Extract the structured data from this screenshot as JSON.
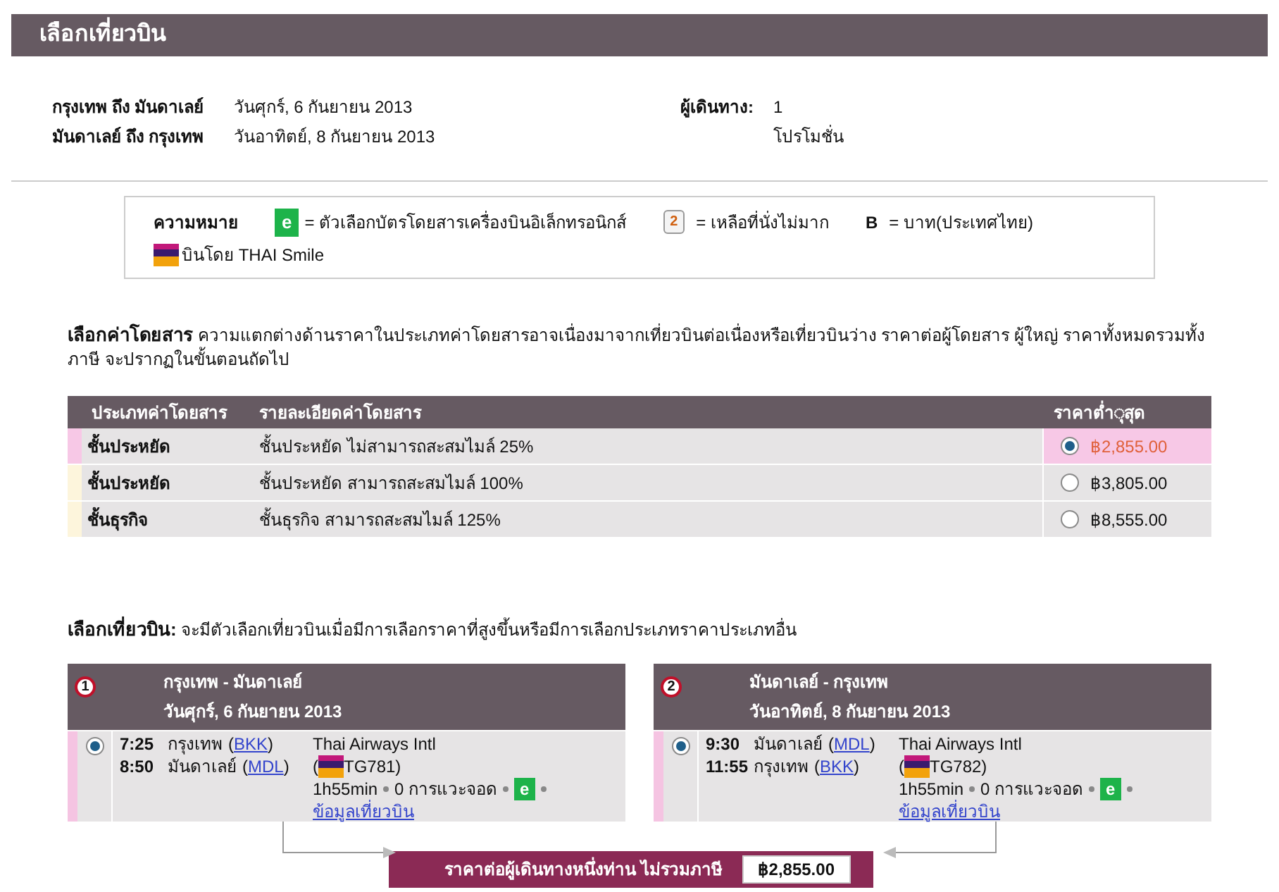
{
  "title": "เลือกเที่ยวบิน",
  "trip": {
    "routes": [
      {
        "label": "กรุงเทพ ถึง มันดาเลย์",
        "date": "วันศุกร์, 6 กันยายน 2013"
      },
      {
        "label": "มันดาเลย์ ถึง กรุงเทพ",
        "date": "วันอาทิตย์, 8 กันยายน 2013"
      }
    ],
    "passengers_label": "ผู้เดินทาง:",
    "passengers_value": "1",
    "promo": "โปรโมชั่น"
  },
  "legend": {
    "label": "ความหมาย",
    "items": [
      {
        "kind": "eticket",
        "icon": "e",
        "text": "= ตัวเลือกบัตรโดยสารเครื่องบินอิเล็กทรอนิกส์"
      },
      {
        "kind": "seats",
        "icon": "2",
        "text": "= เหลือที่นั่งไม่มาก"
      },
      {
        "kind": "currency",
        "icon": "B",
        "text": "= บาท(ประเทศไทย)"
      },
      {
        "kind": "smile",
        "text": "บินโดย THAI Smile"
      }
    ]
  },
  "fare_intro": {
    "label": "เลือกค่าโดยสาร",
    "text": "ความแตกต่างด้านราคาในประเภทค่าโดยสารอาจเนื่องมาจากเที่ยวบินต่อเนื่องหรือเที่ยวบินว่าง ราคาต่อผู้โดยสาร ผู้ใหญ่ ราคาทั้งหมดรวมทั้ง ภาษี จะปรากฏในขั้นตอนถัดไป"
  },
  "fare_table": {
    "columns": [
      "ประเภทค่าโดยสาร",
      "รายละเอียดค่าโดยสาร",
      "ราคาต่ำ◌ุสุด"
    ],
    "rows": [
      {
        "type": "ชั้นประหยัด",
        "detail": "ชั้นประหยัด ไม่สามารถสะสมไมล์ 25%",
        "price": "฿2,855.00",
        "selected": true
      },
      {
        "type": "ชั้นประหยัด",
        "detail": "ชั้นประหยัด สามารถสะสมไมล์ 100%",
        "price": "฿3,805.00",
        "selected": false
      },
      {
        "type": "ชั้นธุรกิจ",
        "detail": "ชั้นธุรกิจ สามารถสะสมไมล์ 125%",
        "price": "฿8,555.00",
        "selected": false
      }
    ]
  },
  "flight_intro": {
    "label": "เลือกเที่ยวบิน:",
    "text": "จะมีตัวเลือกเที่ยวบินเมื่อมีการเลือกราคาที่สูงขึ้นหรือมีการเลือกประเภทราคาประเภทอื่น"
  },
  "flights": [
    {
      "number": "1",
      "route": "กรุงเทพ - มันดาเลย์",
      "date": "วันศุกร์, 6 กันยายน 2013",
      "selected": true,
      "depart_time": "7:25",
      "depart_city": "กรุงเทพ",
      "depart_open": "(",
      "depart_code": "BKK",
      "depart_close": ")",
      "arrive_time": "8:50",
      "arrive_city": "มันดาเลย์",
      "arrive_open": "(",
      "arrive_code": "MDL",
      "arrive_close": ")",
      "airline": "Thai Airways Intl",
      "paren": "(",
      "flight_code": "TG781)",
      "duration": "1h55min",
      "stops": "0 การแวะจอด",
      "eticket": "e",
      "info_link": "ข้อมูลเที่ยวบิน"
    },
    {
      "number": "2",
      "route": "มันดาเลย์ - กรุงเทพ",
      "date": "วันอาทิตย์, 8 กันยายน 2013",
      "selected": true,
      "depart_time": "9:30",
      "depart_city": "มันดาเลย์",
      "depart_open": "(",
      "depart_code": "MDL",
      "depart_close": ")",
      "arrive_time": "11:55",
      "arrive_city": "กรุงเทพ",
      "arrive_open": "(",
      "arrive_code": "BKK",
      "arrive_close": ")",
      "airline": "Thai Airways Intl",
      "paren": "(",
      "flight_code": "TG782)",
      "duration": "1h55min",
      "stops": "0 การแวะจอด",
      "eticket": "e",
      "info_link": "ข้อมูลเที่ยวบิน"
    }
  ],
  "total": {
    "label": "ราคาต่อผู้เดินทางหนึ่งท่าน ไม่รวมภาษี",
    "price": "฿2,855.00"
  }
}
